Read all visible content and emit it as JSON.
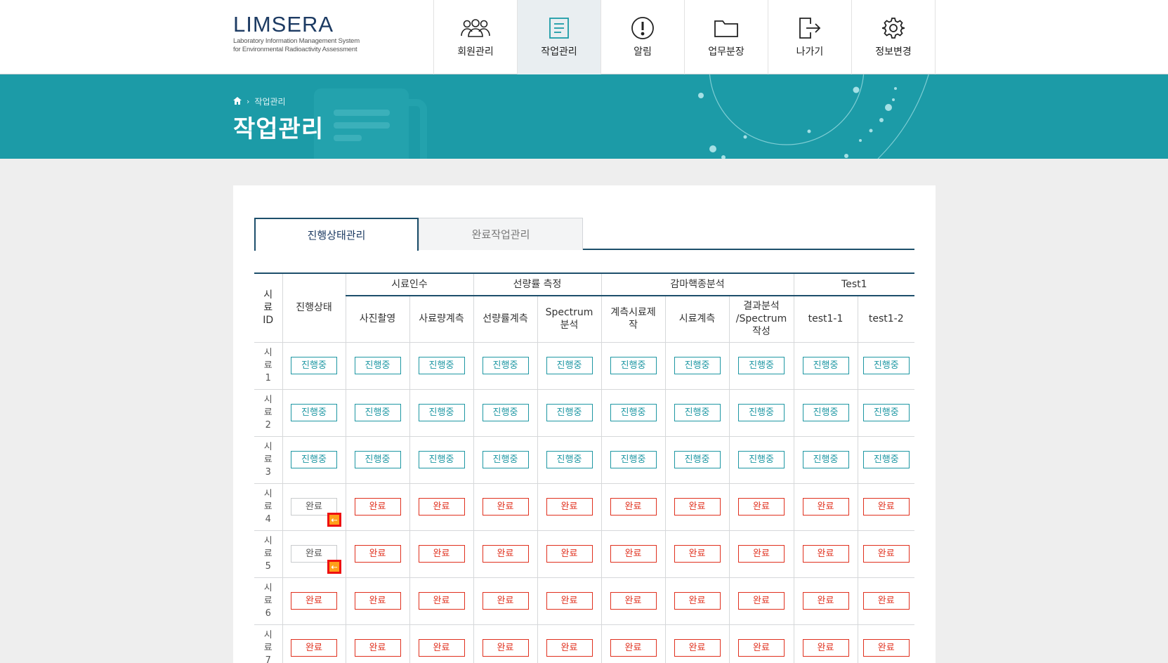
{
  "logo": {
    "title": "LIMSERA",
    "subtitle_line1": "Laboratory Information Management System",
    "subtitle_line2": "for Environmental Radioactivity Assessment"
  },
  "nav": [
    {
      "label": "회원관리",
      "icon": "users-icon",
      "active": false
    },
    {
      "label": "작업관리",
      "icon": "document-icon",
      "active": true
    },
    {
      "label": "알림",
      "icon": "alert-icon",
      "active": false
    },
    {
      "label": "업무분장",
      "icon": "folder-icon",
      "active": false
    },
    {
      "label": "나가기",
      "icon": "logout-icon",
      "active": false
    },
    {
      "label": "정보변경",
      "icon": "gear-icon",
      "active": false
    }
  ],
  "banner": {
    "breadcrumb_home_icon": "home-icon",
    "breadcrumb_current": "작업관리",
    "title": "작업관리",
    "color": "#1c9ba7"
  },
  "tabs": [
    {
      "label": "진행상태관리",
      "active": true
    },
    {
      "label": "완료작업관리",
      "active": false
    }
  ],
  "table": {
    "col_sample_id": "시\n료\nID",
    "col_status": "진행상태",
    "groups": [
      "시료인수",
      "선량률 측정",
      "감마핵종분석",
      "Test1"
    ],
    "subcols": [
      "사진촬영",
      "사료량계측",
      "선량률계측",
      "Spectrum\n분석",
      "계측시료제\n작",
      "시료계측",
      "결과분석\n/Spectrum\n작성",
      "test1-1",
      "test1-2"
    ],
    "rows": [
      {
        "id": "시\n료\n1",
        "status": "진행중",
        "status_kind": "prog",
        "back": false,
        "cells": [
          "진행중",
          "진행중",
          "진행중",
          "진행중",
          "진행중",
          "진행중",
          "진행중",
          "진행중",
          "진행중"
        ],
        "kind": "prog"
      },
      {
        "id": "시\n료\n2",
        "status": "진행중",
        "status_kind": "prog",
        "back": false,
        "cells": [
          "진행중",
          "진행중",
          "진행중",
          "진행중",
          "진행중",
          "진행중",
          "진행중",
          "진행중",
          "진행중"
        ],
        "kind": "prog"
      },
      {
        "id": "시\n료\n3",
        "status": "진행중",
        "status_kind": "prog",
        "back": false,
        "cells": [
          "진행중",
          "진행중",
          "진행중",
          "진행중",
          "진행중",
          "진행중",
          "진행중",
          "진행중",
          "진행중"
        ],
        "kind": "prog"
      },
      {
        "id": "시\n료\n4",
        "status": "완료",
        "status_kind": "gray",
        "back": true,
        "cells": [
          "완료",
          "완료",
          "완료",
          "완료",
          "완료",
          "완료",
          "완료",
          "완료",
          "완료"
        ],
        "kind": "done"
      },
      {
        "id": "시\n료\n5",
        "status": "완료",
        "status_kind": "gray",
        "back": true,
        "cells": [
          "완료",
          "완료",
          "완료",
          "완료",
          "완료",
          "완료",
          "완료",
          "완료",
          "완료"
        ],
        "kind": "done"
      },
      {
        "id": "시\n료\n6",
        "status": "완료",
        "status_kind": "done",
        "back": false,
        "cells": [
          "완료",
          "완료",
          "완료",
          "완료",
          "완료",
          "완료",
          "완료",
          "완료",
          "완료"
        ],
        "kind": "done"
      },
      {
        "id": "시\n료\n7",
        "status": "완료",
        "status_kind": "done",
        "back": false,
        "cells": [
          "완료",
          "완료",
          "완료",
          "완료",
          "완료",
          "완료",
          "완료",
          "완료",
          "완료"
        ],
        "kind": "done"
      }
    ],
    "back_icon": "arrow-left-icon"
  }
}
